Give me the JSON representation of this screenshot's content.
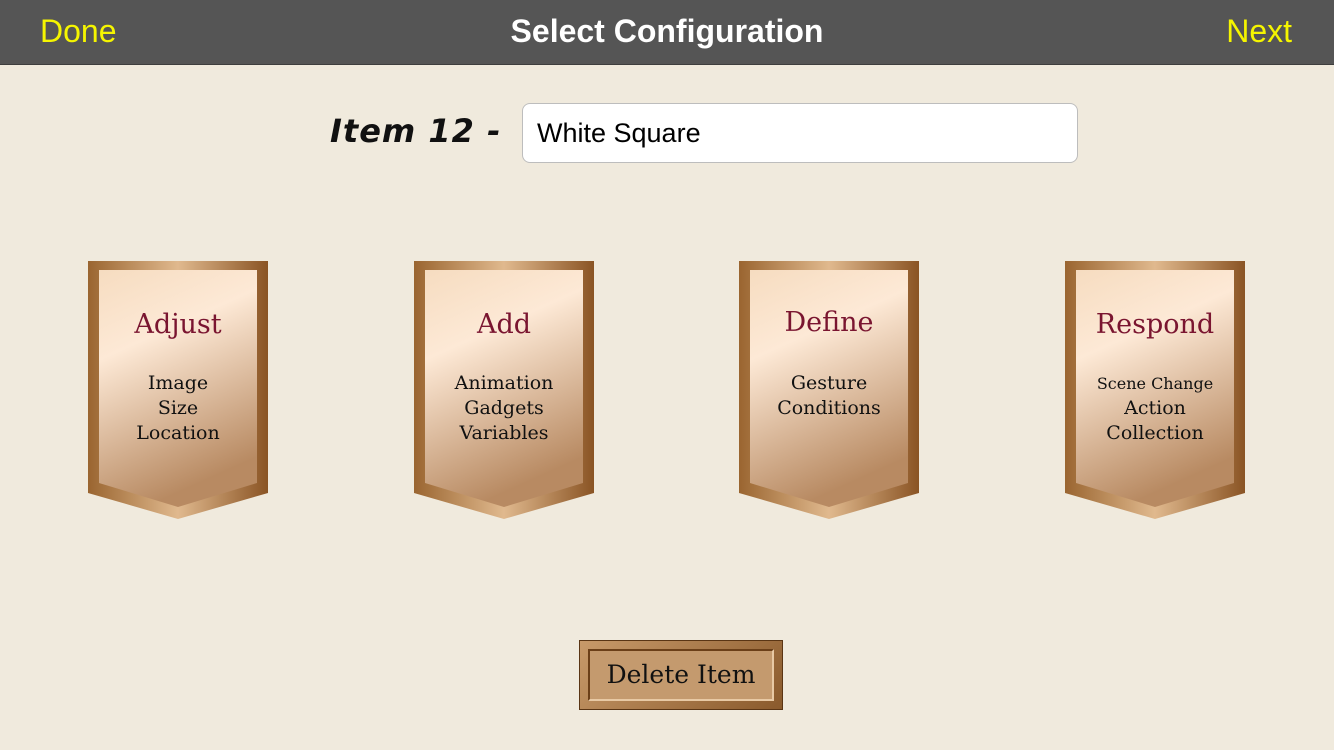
{
  "navbar": {
    "done_label": "Done",
    "title": "Select Configuration",
    "next_label": "Next"
  },
  "item": {
    "label": "Item 12 -",
    "name_value": "White Square"
  },
  "banners": [
    {
      "title": "Adjust",
      "lines": [
        "Image",
        "Size",
        "Location"
      ]
    },
    {
      "title": "Add",
      "lines": [
        "Animation",
        "Gadgets",
        "Variables"
      ]
    },
    {
      "title": "Define",
      "lines": [
        "Gesture",
        "Conditions"
      ]
    },
    {
      "title": "Respond",
      "lines": [
        "Scene Change",
        "Action",
        "Collection"
      ]
    }
  ],
  "footer": {
    "delete_label": "Delete Item"
  },
  "colors": {
    "navbar_bg": "#555555",
    "nav_button": "#f5f500",
    "page_bg": "#f0eadd",
    "banner_title": "#7a1530"
  }
}
